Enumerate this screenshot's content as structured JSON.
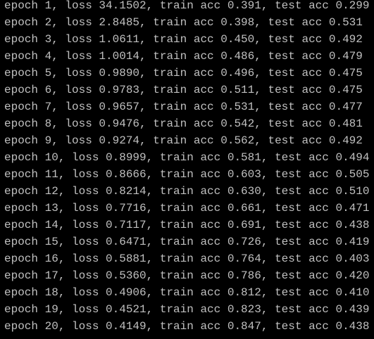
{
  "terminal": {
    "lines": [
      "epoch 1, loss 34.1502, train acc 0.391, test acc 0.299",
      "epoch 2, loss 2.8485, train acc 0.398, test acc 0.531",
      "epoch 3, loss 1.0611, train acc 0.450, test acc 0.492",
      "epoch 4, loss 1.0014, train acc 0.486, test acc 0.479",
      "epoch 5, loss 0.9890, train acc 0.496, test acc 0.475",
      "epoch 6, loss 0.9783, train acc 0.511, test acc 0.475",
      "epoch 7, loss 0.9657, train acc 0.531, test acc 0.477",
      "epoch 8, loss 0.9476, train acc 0.542, test acc 0.481",
      "epoch 9, loss 0.9274, train acc 0.562, test acc 0.492",
      "epoch 10, loss 0.8999, train acc 0.581, test acc 0.494",
      "epoch 11, loss 0.8666, train acc 0.603, test acc 0.505",
      "epoch 12, loss 0.8214, train acc 0.630, test acc 0.510",
      "epoch 13, loss 0.7716, train acc 0.661, test acc 0.471",
      "epoch 14, loss 0.7117, train acc 0.691, test acc 0.438",
      "epoch 15, loss 0.6471, train acc 0.726, test acc 0.419",
      "epoch 16, loss 0.5881, train acc 0.764, test acc 0.403",
      "epoch 17, loss 0.5360, train acc 0.786, test acc 0.420",
      "epoch 18, loss 0.4906, train acc 0.812, test acc 0.410",
      "epoch 19, loss 0.4521, train acc 0.823, test acc 0.439",
      "epoch 20, loss 0.4149, train acc 0.847, test acc 0.438"
    ],
    "prompt": ""
  },
  "colors": {
    "background": "#000000",
    "foreground": "#c0c0c0"
  }
}
